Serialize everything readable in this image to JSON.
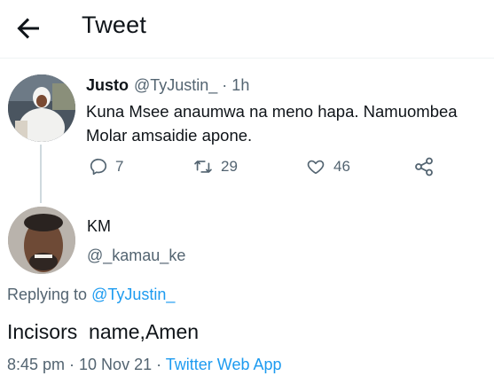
{
  "header": {
    "title": "Tweet",
    "back_icon": "arrow-left-icon"
  },
  "parent_tweet": {
    "author_name": "Justo",
    "handle_time": "@TyJustin_ · 1h",
    "text": "Kuna Msee anaumwa na meno hapa. Namuombea Molar amsaidie apone.",
    "actions": {
      "replies": "7",
      "retweets": "29",
      "likes": "46"
    }
  },
  "reply": {
    "author_name": "KM",
    "handle": "@_kamau_ke",
    "replying_prefix": "Replying to ",
    "replying_to": "@TyJustin_",
    "text": "Incisors  name,Amen",
    "timestamp": "8:45 pm · 10 Nov 21 · ",
    "source": "Twitter Web App"
  },
  "colors": {
    "text": "#0f1419",
    "secondary": "#536471",
    "link": "#1d9bf0",
    "divider": "#eff3f4"
  }
}
